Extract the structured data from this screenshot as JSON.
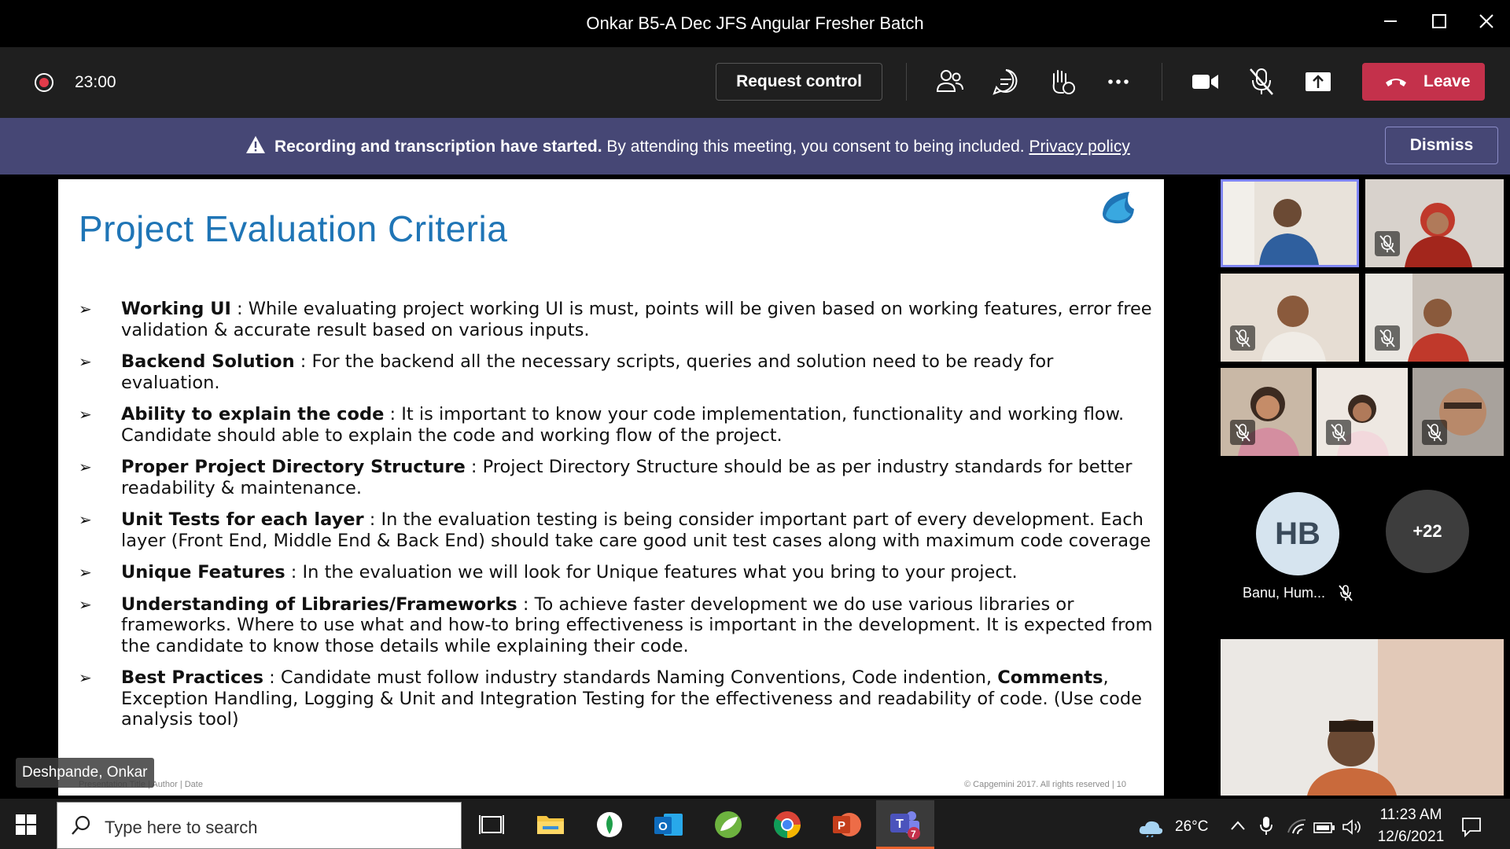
{
  "window": {
    "title": "Onkar B5-A Dec JFS Angular Fresher Batch"
  },
  "toolbar": {
    "recording_time": "23:00",
    "request_control_label": "Request control",
    "leave_label": "Leave",
    "icons": [
      "people-icon",
      "chat-icon",
      "raise-hand-icon",
      "more-icon",
      "camera-icon",
      "mic-off-icon",
      "share-icon"
    ]
  },
  "banner": {
    "bold_text": "Recording and transcription have started.",
    "text": " By attending this meeting, you consent to being included. ",
    "link": "Privacy policy",
    "dismiss_label": "Dismiss",
    "color": "#464775"
  },
  "slide": {
    "title": "Project Evaluation Criteria",
    "bullets": [
      {
        "head": "Working UI",
        "text": " : While evaluating project working UI is must, points will be given based on working features, error free validation & accurate result based on various inputs."
      },
      {
        "head": "Backend Solution",
        "text": " : For the backend all the necessary scripts, queries and solution need to be ready for evaluation."
      },
      {
        "head": "Ability to explain the code",
        "text": " : It is important to know your code implementation, functionality and working flow. Candidate should able to explain the code and working flow of the project."
      },
      {
        "head": "Proper Project Directory Structure",
        "text": " : Project Directory Structure should be as per industry standards for better readability & maintenance."
      },
      {
        "head": "Unit Tests for each layer",
        "text": " : In the evaluation testing is being consider important part of every development. Each layer (Front End, Middle End & Back End) should take care good unit test cases along with maximum code coverage"
      },
      {
        "head": "Unique Features",
        "text": " : In the evaluation we will look for Unique features what you bring to your project."
      },
      {
        "head": "Understanding of Libraries/Frameworks",
        "text": " : To achieve faster development we do use various libraries or frameworks. Where to use what and how-to bring effectiveness is important in the development. It is expected from the candidate to know those details while explaining their code."
      },
      {
        "head": "Best Practices",
        "text": " : Candidate must follow industry standards Naming Conventions, Code indention, ",
        "bold2": "Comments",
        "text2": ", Exception Handling, Logging & Unit and Integration Testing for the effectiveness and readability of code. (Use code analysis tool)"
      }
    ],
    "footer_left": "Presentation Title | Author | Date",
    "footer_right": "© Capgemini 2017. All rights reserved  |  10",
    "title_color": "#1f75b6"
  },
  "presenter_name": "Deshpande, Onkar",
  "participants": {
    "initials": "HB",
    "name": "Banu, Hum...",
    "overflow_count": "+22"
  },
  "taskbar": {
    "search_placeholder": "Type here to search",
    "temperature": "26°C",
    "time": "11:23 AM",
    "date": "12/6/2021",
    "teams_badge": "7"
  }
}
